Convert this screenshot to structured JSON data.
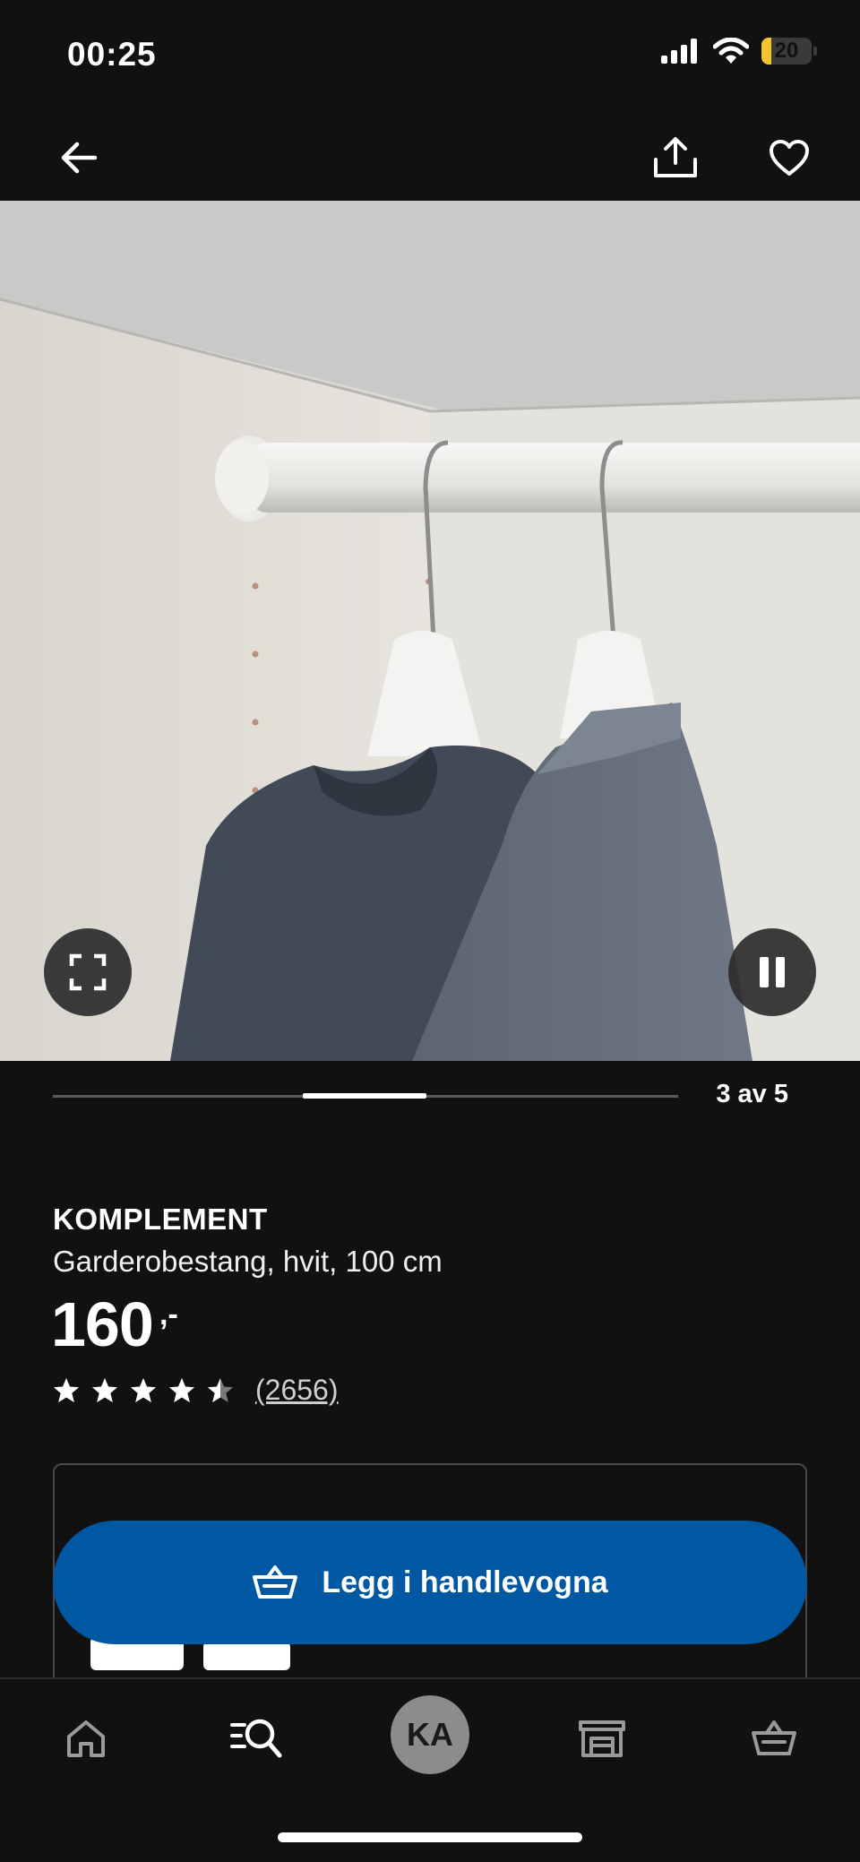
{
  "status_bar": {
    "time": "00:25",
    "battery_level": "20",
    "battery_fraction": 0.2
  },
  "top_nav": {
    "back_icon": "arrow-left-icon",
    "share_icon": "share-icon",
    "favorite_icon": "heart-icon"
  },
  "media": {
    "fullscreen_icon": "fullscreen-icon",
    "pause_icon": "pause-icon",
    "progress_fraction": 0.6,
    "slide_counter": "3 av 5",
    "current_slide": 3,
    "total_slides": 5
  },
  "product": {
    "name": "KOMPLEMENT",
    "description": "Garderobestang, hvit, 100 cm",
    "price": "160",
    "price_suffix": ",-",
    "rating": 4.5,
    "review_count": "(2656)"
  },
  "cart": {
    "label": "Legg i handlevogna",
    "icon": "basket-icon"
  },
  "tab_bar": {
    "items": [
      {
        "name": "home",
        "icon": "home-icon"
      },
      {
        "name": "search",
        "icon": "search-icon"
      },
      {
        "name": "profile",
        "initials": "KA"
      },
      {
        "name": "store",
        "icon": "store-icon"
      },
      {
        "name": "cart",
        "icon": "basket-icon"
      }
    ]
  },
  "colors": {
    "background": "#111111",
    "accent": "#0058a3",
    "battery": "#f4c430"
  }
}
